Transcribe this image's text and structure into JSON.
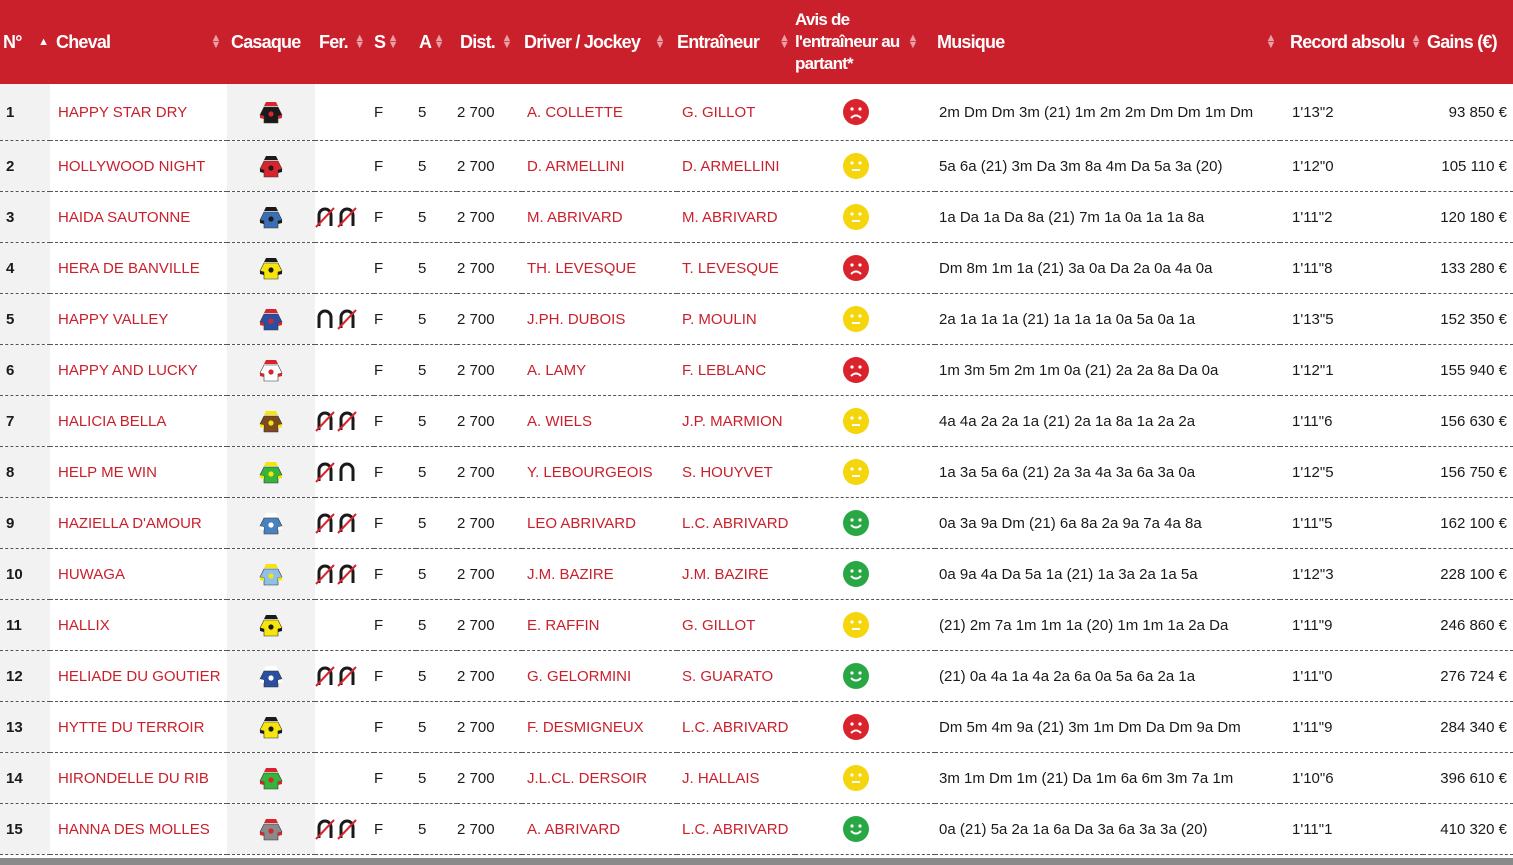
{
  "headers": {
    "num": "N°",
    "cheval": "Cheval",
    "casaque": "Casaque",
    "fer": "Fer.",
    "s": "S",
    "a": "A",
    "dist": "Dist.",
    "driver": "Driver / Jockey",
    "entraineur": "Entraîneur",
    "avis": "Avis de l'entraîneur au partant*",
    "musique": "Musique",
    "record": "Record absolu",
    "gains": "Gains (€)"
  },
  "colors": {
    "header_bg": "#c9202c",
    "link": "#c9202c",
    "happy": "#29a745",
    "neutral": "#f5d50c",
    "sad": "#d9232d"
  },
  "rows": [
    {
      "num": "1",
      "name": "HAPPY STAR DRY",
      "silk": "#1a1a1a",
      "silk2": "#d9232d",
      "shoes": "",
      "s": "F",
      "a": "5",
      "dist": "2 700",
      "driver": "A. COLLETTE",
      "trainer": "G. GILLOT",
      "avis": "sad",
      "musique": "2m Dm Dm 3m (21) 1m 2m 2m Dm Dm 1m Dm",
      "record": "1'13\"2",
      "gains": "93 850 €"
    },
    {
      "num": "2",
      "name": "HOLLYWOOD NIGHT",
      "silk": "#d9232d",
      "silk2": "#1a1a1a",
      "shoes": "",
      "s": "F",
      "a": "5",
      "dist": "2 700",
      "driver": "D. ARMELLINI",
      "trainer": "D. ARMELLINI",
      "avis": "neutral",
      "musique": "5a 6a (21) 3m Da 3m 8a 4m Da 5a 3a (20)",
      "record": "1'12\"0",
      "gains": "105 110 €"
    },
    {
      "num": "3",
      "name": "HAIDA SAUTONNE",
      "silk": "#3a6fb5",
      "silk2": "#1a1a1a",
      "shoes": "DD",
      "s": "F",
      "a": "5",
      "dist": "2 700",
      "driver": "M. ABRIVARD",
      "trainer": "M. ABRIVARD",
      "avis": "neutral",
      "musique": "1a Da 1a Da 8a (21) 7m 1a 0a 1a 1a 8a",
      "record": "1'11\"2",
      "gains": "120 180 €"
    },
    {
      "num": "4",
      "name": "HERA DE BANVILLE",
      "silk": "#f5e50c",
      "silk2": "#1a1a1a",
      "shoes": "",
      "s": "F",
      "a": "5",
      "dist": "2 700",
      "driver": "TH. LEVESQUE",
      "trainer": "T. LEVESQUE",
      "avis": "sad",
      "musique": "Dm 8m 1m 1a (21) 3a 0a Da 2a 0a 4a 0a",
      "record": "1'11\"8",
      "gains": "133 280 €"
    },
    {
      "num": "5",
      "name": "HAPPY VALLEY",
      "silk": "#2a4fa0",
      "silk2": "#d9232d",
      "shoes": "PD",
      "s": "F",
      "a": "5",
      "dist": "2 700",
      "driver": "J.PH. DUBOIS",
      "trainer": "P. MOULIN",
      "avis": "neutral",
      "musique": "2a 1a 1a 1a (21) 1a 1a 1a 0a 5a 0a 1a",
      "record": "1'13\"5",
      "gains": "152 350 €"
    },
    {
      "num": "6",
      "name": "HAPPY AND LUCKY",
      "silk": "#ffffff",
      "silk2": "#d9232d",
      "shoes": "",
      "s": "F",
      "a": "5",
      "dist": "2 700",
      "driver": "A. LAMY",
      "trainer": "F. LEBLANC",
      "avis": "sad",
      "musique": "1m 3m 5m 2m 1m 0a (21) 2a 2a 8a Da 0a",
      "record": "1'12\"1",
      "gains": "155 940 €"
    },
    {
      "num": "7",
      "name": "HALICIA BELLA",
      "silk": "#7a4a1e",
      "silk2": "#f5e50c",
      "shoes": "DD",
      "s": "F",
      "a": "5",
      "dist": "2 700",
      "driver": "A. WIELS",
      "trainer": "J.P. MARMION",
      "avis": "neutral",
      "musique": "4a 4a 2a 2a 1a (21) 2a 1a 8a 1a 2a 2a",
      "record": "1'11\"6",
      "gains": "156 630 €"
    },
    {
      "num": "8",
      "name": "HELP ME WIN",
      "silk": "#35b53a",
      "silk2": "#f5e50c",
      "shoes": "DP",
      "s": "F",
      "a": "5",
      "dist": "2 700",
      "driver": "Y. LEBOURGEOIS",
      "trainer": "S. HOUYVET",
      "avis": "neutral",
      "musique": "1a 3a 5a 6a (21) 2a 3a 4a 3a 6a 3a 0a",
      "record": "1'12\"5",
      "gains": "156 750 €"
    },
    {
      "num": "9",
      "name": "HAZIELLA D'AMOUR",
      "silk": "#4a82c0",
      "silk2": "#ffffff",
      "shoes": "DD",
      "s": "F",
      "a": "5",
      "dist": "2 700",
      "driver": "LEO ABRIVARD",
      "trainer": "L.C. ABRIVARD",
      "avis": "happy",
      "musique": "0a 3a 9a Dm (21) 6a 8a 2a 9a 7a 4a 8a",
      "record": "1'11\"5",
      "gains": "162 100 €"
    },
    {
      "num": "10",
      "name": "HUWAGA",
      "silk": "#8fc0e8",
      "silk2": "#f5e50c",
      "shoes": "DD",
      "s": "F",
      "a": "5",
      "dist": "2 700",
      "driver": "J.M. BAZIRE",
      "trainer": "J.M. BAZIRE",
      "avis": "happy",
      "musique": "0a 9a 4a Da 5a 1a (21) 1a 3a 2a 1a 5a",
      "record": "1'12\"3",
      "gains": "228 100 €"
    },
    {
      "num": "11",
      "name": "HALLIX",
      "silk": "#f5e50c",
      "silk2": "#1a1a1a",
      "shoes": "",
      "s": "F",
      "a": "5",
      "dist": "2 700",
      "driver": "E. RAFFIN",
      "trainer": "G. GILLOT",
      "avis": "neutral",
      "musique": "(21) 2m 7a 1m 1m 1a (20) 1m 1m 1a 2a Da",
      "record": "1'11\"9",
      "gains": "246 860 €"
    },
    {
      "num": "12",
      "name": "HELIADE DU GOUTIER",
      "silk": "#2a4fa0",
      "silk2": "#ffffff",
      "shoes": "DD",
      "s": "F",
      "a": "5",
      "dist": "2 700",
      "driver": "G. GELORMINI",
      "trainer": "S. GUARATO",
      "avis": "happy",
      "musique": "(21) 0a 4a 1a 4a 2a 6a 0a 5a 6a 2a 1a",
      "record": "1'11\"0",
      "gains": "276 724 €"
    },
    {
      "num": "13",
      "name": "HYTTE DU TERROIR",
      "silk": "#f5e50c",
      "silk2": "#1a1a1a",
      "shoes": "",
      "s": "F",
      "a": "5",
      "dist": "2 700",
      "driver": "F. DESMIGNEUX",
      "trainer": "L.C. ABRIVARD",
      "avis": "sad",
      "musique": "Dm 5m 4m 9a (21) 3m 1m Dm Da Dm 9a Dm",
      "record": "1'11\"9",
      "gains": "284 340 €"
    },
    {
      "num": "14",
      "name": "HIRONDELLE DU RIB",
      "silk": "#35b53a",
      "silk2": "#d9232d",
      "shoes": "",
      "s": "F",
      "a": "5",
      "dist": "2 700",
      "driver": "J.L.CL. DERSOIR",
      "trainer": "J. HALLAIS",
      "avis": "neutral",
      "musique": "3m 1m Dm 1m (21) Da 1m 6a 6m 3m 7a 1m",
      "record": "1'10\"6",
      "gains": "396 610 €"
    },
    {
      "num": "15",
      "name": "HANNA DES MOLLES",
      "silk": "#8a8a8a",
      "silk2": "#d9232d",
      "shoes": "DD",
      "s": "F",
      "a": "5",
      "dist": "2 700",
      "driver": "A. ABRIVARD",
      "trainer": "L.C. ABRIVARD",
      "avis": "happy",
      "musique": "0a (21) 5a 2a 1a 6a Da 3a 6a 3a 3a (20)",
      "record": "1'11\"1",
      "gains": "410 320 €"
    }
  ]
}
